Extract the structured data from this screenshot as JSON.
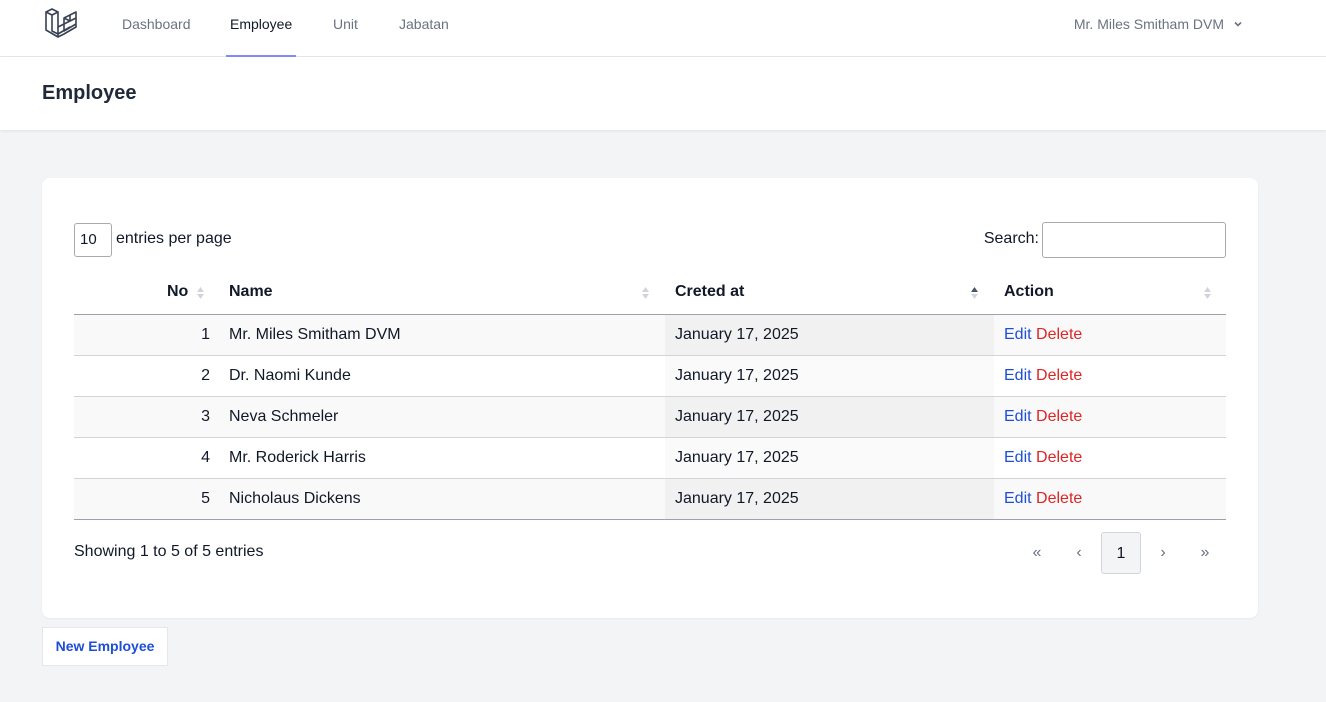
{
  "nav": {
    "items": [
      {
        "label": "Dashboard",
        "active": false
      },
      {
        "label": "Employee",
        "active": true
      },
      {
        "label": "Unit",
        "active": false
      },
      {
        "label": "Jabatan",
        "active": false
      }
    ],
    "user_name": "Mr. Miles Smitham DVM",
    "logo_icon": "laravel-logo-icon",
    "user_menu_icon": "chevron-down-icon"
  },
  "header": {
    "title": "Employee"
  },
  "table_controls": {
    "per_page_value": "10",
    "per_page_label": "entries per page",
    "search_label": "Search:",
    "search_value": ""
  },
  "table": {
    "columns": [
      {
        "label": "No",
        "sort": "none"
      },
      {
        "label": "Name",
        "sort": "none"
      },
      {
        "label": "Creted at",
        "sort": "ascending"
      },
      {
        "label": "Action",
        "sort": "none"
      }
    ],
    "rows": [
      {
        "no": "1",
        "name": "Mr. Miles Smitham DVM",
        "created_at": "January 17, 2025",
        "edit": "Edit",
        "delete": "Delete"
      },
      {
        "no": "2",
        "name": "Dr. Naomi Kunde",
        "created_at": "January 17, 2025",
        "edit": "Edit",
        "delete": "Delete"
      },
      {
        "no": "3",
        "name": "Neva Schmeler",
        "created_at": "January 17, 2025",
        "edit": "Edit",
        "delete": "Delete"
      },
      {
        "no": "4",
        "name": "Mr. Roderick Harris",
        "created_at": "January 17, 2025",
        "edit": "Edit",
        "delete": "Delete"
      },
      {
        "no": "5",
        "name": "Nicholaus Dickens",
        "created_at": "January 17, 2025",
        "edit": "Edit",
        "delete": "Delete"
      }
    ]
  },
  "footer": {
    "info": "Showing 1 to 5 of 5 entries",
    "pagination": {
      "first": "«",
      "prev": "‹",
      "current": "1",
      "next": "›",
      "last": "»"
    }
  },
  "actions": {
    "new_employee": "New Employee"
  },
  "colors": {
    "accent": "#818cf8",
    "link": "#1d4ed8",
    "danger": "#dc2626",
    "background": "#f3f4f6"
  }
}
